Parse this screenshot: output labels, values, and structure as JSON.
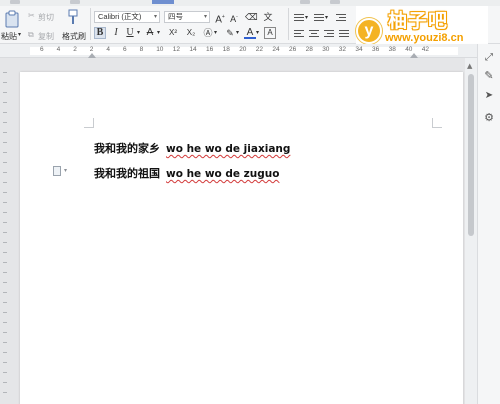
{
  "ribbon": {
    "paste_label": "粘贴",
    "cut_label": "剪切",
    "copy_label": "复制",
    "format_painter_label": "格式刷",
    "font_name": "Calibri (正文)",
    "font_size": "四号",
    "bold_label": "B",
    "italic_label": "I",
    "underline_label": "U",
    "strike_label": "A",
    "superscript_label": "X²",
    "subscript_label": "X₂",
    "font_color_label": "A",
    "char_border_label": "A"
  },
  "watermark": {
    "logo_letter": "y",
    "title": "柚子吧",
    "url": "www.youzi8.cn"
  },
  "ruler": {
    "numbers": [
      "6",
      "4",
      "2",
      "2",
      "4",
      "6",
      "8",
      "10",
      "12",
      "14",
      "16",
      "18",
      "20",
      "22",
      "24",
      "26",
      "28",
      "30",
      "32",
      "34",
      "36",
      "38",
      "40",
      "42"
    ]
  },
  "document": {
    "lines": [
      {
        "hanzi": "我和我的家乡",
        "pinyin": "wo he wo de jiaxiang"
      },
      {
        "hanzi": "我和我的祖国",
        "pinyin": "wo he wo de zuguo"
      }
    ]
  },
  "colors": {
    "watermark_orange": "#f4a000",
    "spell_underline": "#d23a3a",
    "page_background": "#ffffff",
    "workspace": "#e5e6e8"
  }
}
